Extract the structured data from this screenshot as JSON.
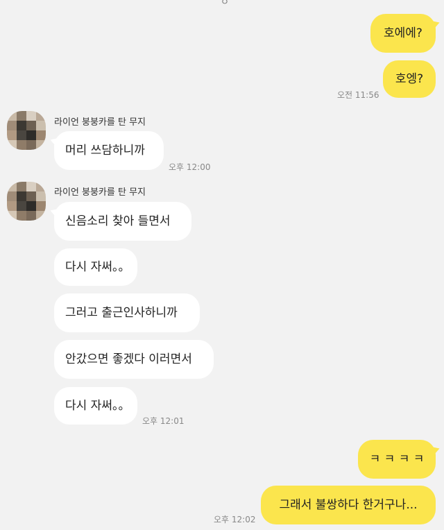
{
  "top_fragment": "ㅇ",
  "messages": {
    "m1": "호에에?",
    "m2": "호엥?",
    "t1": "오전 11:56",
    "sender1": "라이언 붕붕카를 탄 무지",
    "m3": "머리 쓰담하니까",
    "t2": "오후 12:00",
    "sender2": "라이언 붕붕카를 탄 무지",
    "m4": "신음소리 찾아 들면서",
    "m5": "다시 자써。。",
    "m6": "그러고 출근인사하니까",
    "m7": "안갔으면 좋겠다 이러면서",
    "m8": "다시 자써。。",
    "t3": "오후 12:01",
    "m9": "ㅋ ㅋ ㅋ ㅋ",
    "m10": "그래서 불쌍하다 한거구나...",
    "t4": "오후 12:02"
  },
  "colors": {
    "my_bubble": "#fbe54d",
    "their_bubble": "#ffffff",
    "background": "#f2f2f2"
  }
}
